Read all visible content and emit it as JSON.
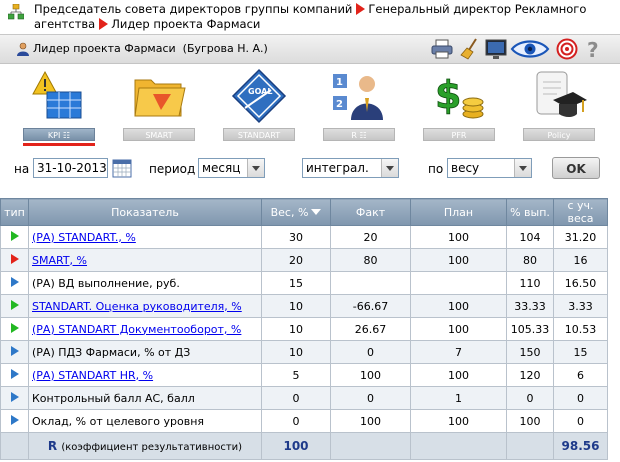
{
  "breadcrumb": {
    "items": [
      "Председатель совета директоров группы компаний",
      "Генеральный директор Рекламного агентства",
      "Лидер проекта Фармаси"
    ]
  },
  "header": {
    "title": "Лидер проекта Фармаси",
    "person": "(Бугрова Н. А.)",
    "tools": [
      "printer-icon",
      "broom-icon",
      "monitor-icon",
      "eye-icon",
      "target-icon",
      "help-icon"
    ]
  },
  "modules": [
    {
      "label": "KPI ☷",
      "active": true
    },
    {
      "label": "SMART",
      "active": false
    },
    {
      "label": "STANDART",
      "active": false
    },
    {
      "label": "R ☷",
      "active": false
    },
    {
      "label": "PFR",
      "active": false
    },
    {
      "label": "Policy",
      "active": false
    }
  ],
  "filters": {
    "date_label": "на",
    "date_value": "31-10-2013",
    "period_label": "период",
    "period_value": "месяц",
    "mode_value": "интеграл.",
    "sort_label": "по",
    "sort_value": "весу",
    "ok_label": "OK"
  },
  "table": {
    "headers": [
      "тип",
      "Показатель",
      "Вес, %",
      "Факт",
      "План",
      "% вып.",
      "с уч. веса"
    ],
    "rows": [
      {
        "type": "green",
        "name": "(РА) STANDART., %",
        "link": true,
        "weight": "30",
        "fact": "20",
        "plan": "100",
        "pct": "104",
        "weighted": "31.20"
      },
      {
        "type": "red",
        "name": "SMART, %",
        "link": true,
        "weight": "20",
        "fact": "80",
        "plan": "100",
        "pct": "80",
        "weighted": "16"
      },
      {
        "type": "blue",
        "name": "(РА) ВД выполнение, руб.",
        "link": false,
        "weight": "15",
        "fact": "",
        "plan": "",
        "pct": "110",
        "weighted": "16.50"
      },
      {
        "type": "green",
        "name": "STANDART. Оценка руководителя, %",
        "link": true,
        "weight": "10",
        "fact": "-66.67",
        "plan": "100",
        "pct": "33.33",
        "weighted": "3.33"
      },
      {
        "type": "green",
        "name": "(РА) STANDART Документооборот, %",
        "link": true,
        "weight": "10",
        "fact": "26.67",
        "plan": "100",
        "pct": "105.33",
        "weighted": "10.53"
      },
      {
        "type": "blue",
        "name": "(РА) ПДЗ Фармаси, % от ДЗ",
        "link": false,
        "weight": "10",
        "fact": "0",
        "plan": "7",
        "pct": "150",
        "weighted": "15"
      },
      {
        "type": "blue",
        "name": "(РА) STANDART HR, %",
        "link": true,
        "weight": "5",
        "fact": "100",
        "plan": "100",
        "pct": "120",
        "weighted": "6"
      },
      {
        "type": "blue",
        "name": "Контрольный балл АС, балл",
        "link": false,
        "weight": "0",
        "fact": "0",
        "plan": "1",
        "pct": "0",
        "weighted": "0"
      },
      {
        "type": "blue",
        "name": "Оклад, % от целевого уровня",
        "link": false,
        "weight": "0",
        "fact": "100",
        "plan": "100",
        "pct": "100",
        "weighted": "0"
      }
    ],
    "total": {
      "label": "R",
      "sublabel": "(коэффициент результативности)",
      "weight": "100",
      "weighted": "98.56"
    }
  }
}
